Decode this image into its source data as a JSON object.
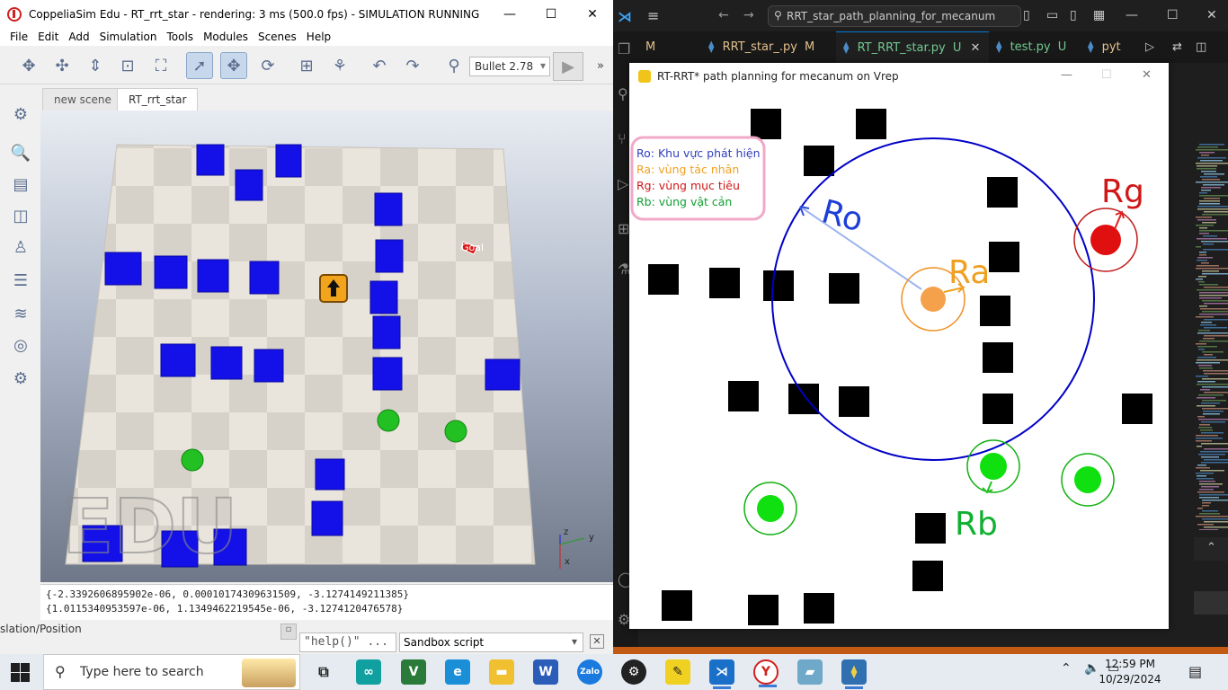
{
  "coppelia": {
    "title": "CoppeliaSim Edu - RT_rrt_star - rendering: 3 ms (500.0 fps) - SIMULATION RUNNING",
    "menu": [
      "File",
      "Edit",
      "Add",
      "Simulation",
      "Tools",
      "Modules",
      "Scenes",
      "Help"
    ],
    "physics_engine": "Bullet 2.78",
    "tabs": [
      "new scene",
      "RT_rrt_star"
    ],
    "watermark": "EDU",
    "goal_label": "Goal",
    "axis_labels": [
      "z",
      "y",
      "x"
    ],
    "console_lines": [
      "{-2.3392606895902e-06, 0.00010174309631509, -3.1274149211385}",
      "{1.0115340953597e-06, 1.1349462219545e-06, -3.1274120476578}"
    ],
    "path_label": "slation/Position",
    "help_text": "\"help()\" ...",
    "sandbox": "Sandbox script"
  },
  "vscode": {
    "search": "RRT_star_path_planning_for_mecanum",
    "tabs": [
      {
        "name": "M",
        "badge": "",
        "color": "#e2c08d"
      },
      {
        "name": "RRT_star_.py",
        "badge": "M",
        "color": "#e2c08d"
      },
      {
        "name": "RT_RRT_star.py",
        "badge": "U",
        "color": "#73c991"
      },
      {
        "name": "test.py",
        "badge": "U",
        "color": "#73c991"
      },
      {
        "name": "pyt",
        "badge": "",
        "color": "#e2c08d"
      }
    ]
  },
  "pygame": {
    "title": "RT-RRT* path planning for mecanum on Vrep",
    "legend": [
      {
        "text": "Ro: Khu vực phát hiện",
        "color": "#2f3fbf"
      },
      {
        "text": "Ra: vùng tác nhân",
        "color": "#f0a020"
      },
      {
        "text": "Rg: vùng mục tiêu",
        "color": "#d01818"
      },
      {
        "text": "Rb: vùng vật cản",
        "color": "#10a030"
      }
    ],
    "annotations": [
      {
        "text": "Ro",
        "color": "#1c3fd8"
      },
      {
        "text": "Ra",
        "color": "#f0a020"
      },
      {
        "text": "Rg",
        "color": "#d01818"
      },
      {
        "text": "Rb",
        "color": "#10b030"
      }
    ]
  },
  "taskbar": {
    "search_placeholder": "Type here to search",
    "time": "12:59 PM",
    "date": "10/29/2024"
  }
}
